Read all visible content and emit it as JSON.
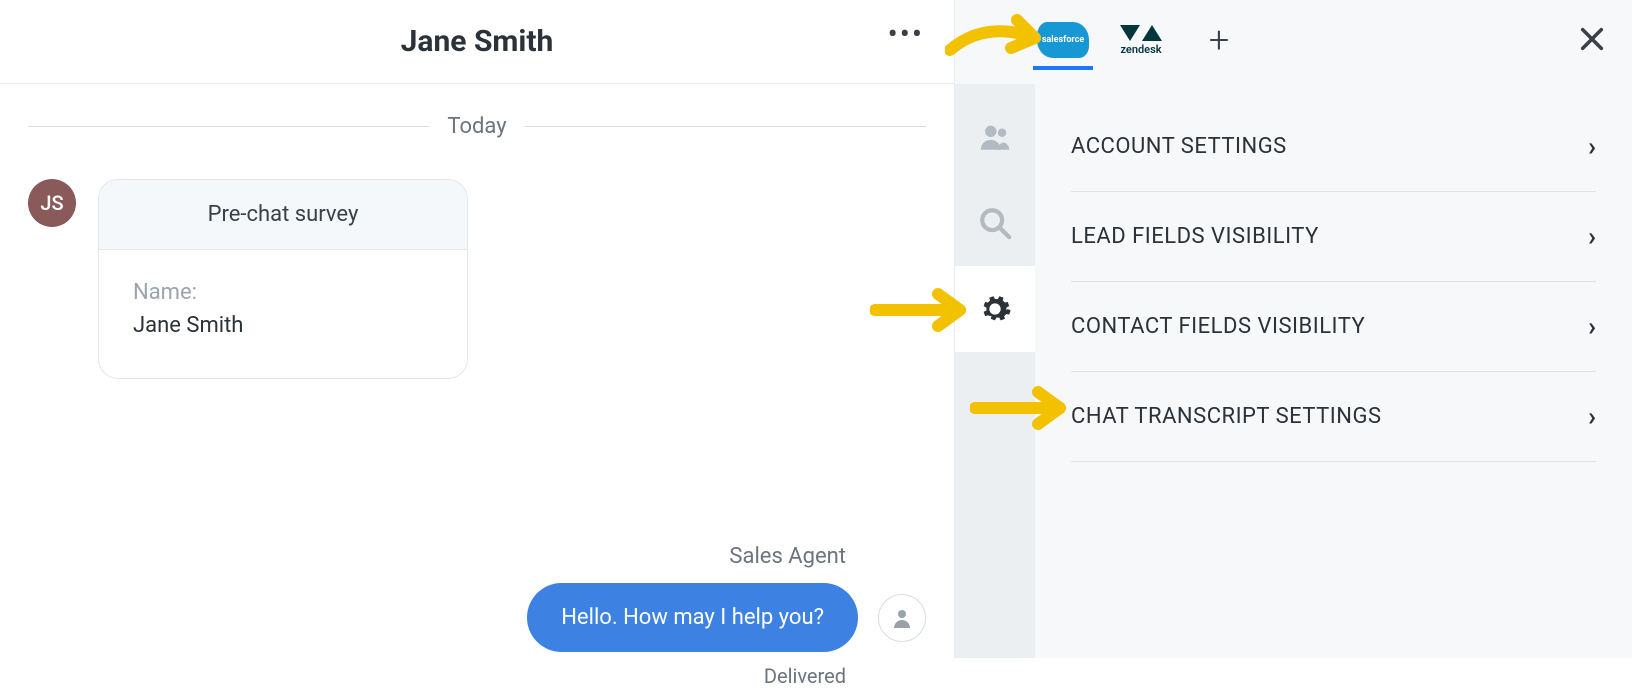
{
  "chat": {
    "title": "Jane Smith",
    "day_label": "Today",
    "avatar_initials": "JS",
    "survey": {
      "heading": "Pre-chat survey",
      "field_label": "Name:",
      "field_value": "Jane Smith"
    },
    "agent": {
      "name": "Sales Agent",
      "message": "Hello. How may I help you?",
      "status": "Delivered"
    }
  },
  "side": {
    "tabs": {
      "salesforce": "salesforce",
      "zendesk": "zendesk",
      "plus": "+"
    },
    "settings": [
      "ACCOUNT SETTINGS",
      "LEAD FIELDS VISIBILITY",
      "CONTACT FIELDS VISIBILITY",
      "CHAT TRANSCRIPT SETTINGS"
    ]
  }
}
